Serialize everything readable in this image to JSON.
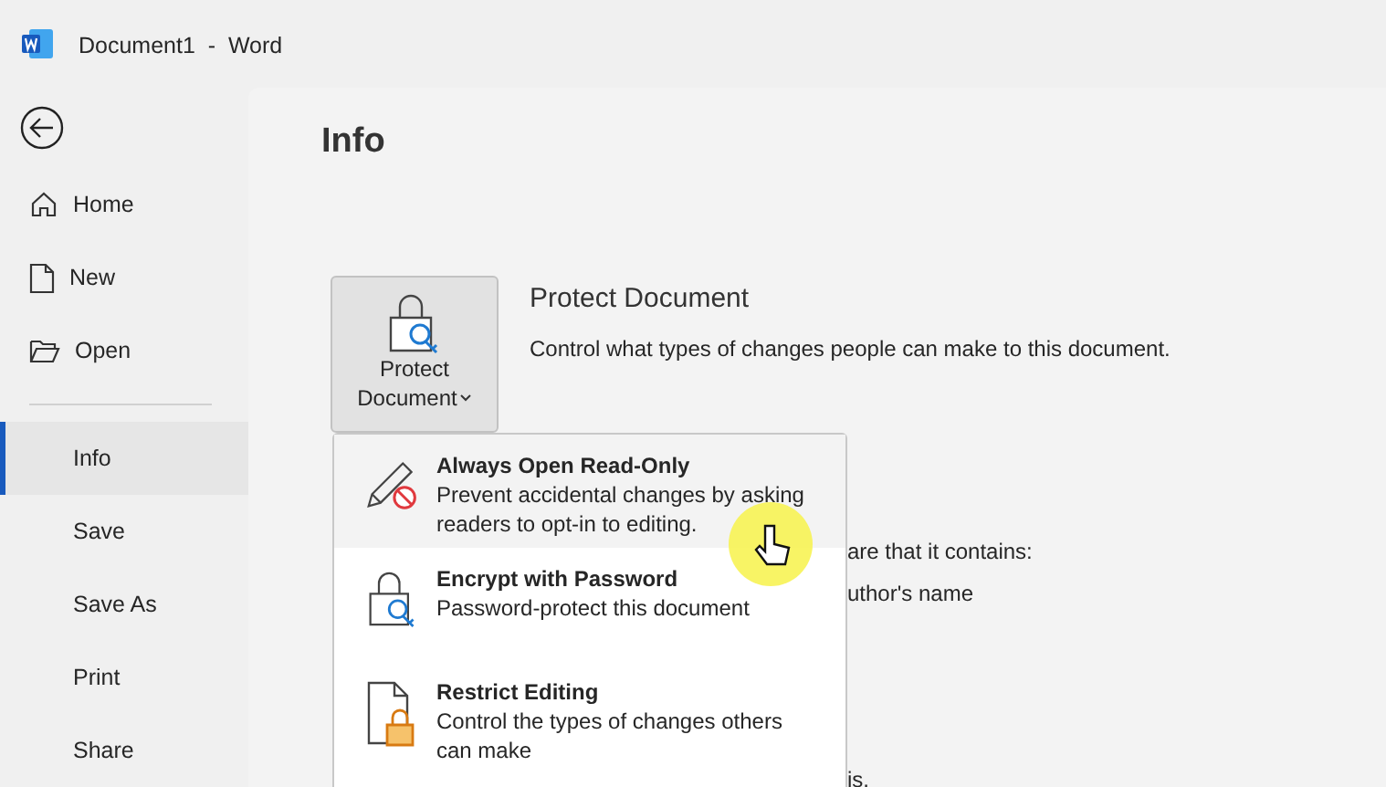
{
  "window": {
    "title": "Document1  -  Word"
  },
  "sidebar": {
    "items": [
      {
        "label": "Home",
        "kind": "home",
        "selected": false
      },
      {
        "label": "New",
        "kind": "new",
        "selected": false
      },
      {
        "label": "Open",
        "kind": "open",
        "selected": false
      },
      {
        "label": "Info",
        "kind": "plain",
        "selected": true
      },
      {
        "label": "Save",
        "kind": "plain",
        "selected": false
      },
      {
        "label": "Save As",
        "kind": "plain",
        "selected": false
      },
      {
        "label": "Print",
        "kind": "plain",
        "selected": false
      },
      {
        "label": "Share",
        "kind": "plain",
        "selected": false
      }
    ]
  },
  "page": {
    "title": "Info",
    "protect": {
      "button_lines": [
        "Protect",
        "Document"
      ],
      "heading": "Protect Document",
      "description": "Control what types of changes people can make to this document."
    },
    "hidden_texts": [
      "are that it contains:",
      "uthor's name",
      "is."
    ]
  },
  "menu": {
    "items": [
      {
        "kind": "readonly",
        "title": "Always Open Read-Only",
        "description": "Prevent accidental changes by asking readers to opt-in to editing.",
        "selected": true
      },
      {
        "kind": "encrypt",
        "title": "Encrypt with Password",
        "description": "Password-protect this document",
        "selected": false
      },
      {
        "kind": "restrict",
        "title": "Restrict Editing",
        "description": "Control the types of changes others can make",
        "selected": false
      }
    ]
  }
}
